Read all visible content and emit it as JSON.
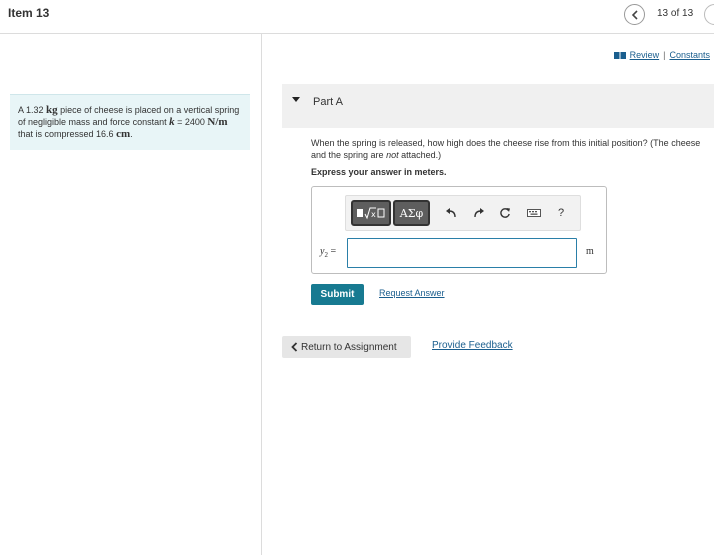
{
  "header": {
    "item_title": "Item 13",
    "page_count": "13 of 13"
  },
  "problem": {
    "text_1": "A 1.32 ",
    "mass_unit": "kg",
    "text_2": " piece of cheese is placed on a vertical spring of negligible mass and force constant ",
    "k_symbol": "k",
    "text_3": " = 2400 ",
    "k_unit": "N/m",
    "text_4": " that is compressed 16.6 ",
    "length_unit": "cm",
    "text_5": "."
  },
  "links": {
    "review": "Review",
    "separator": "|",
    "constants": "Constants"
  },
  "part": {
    "label": "Part A",
    "question_1": "When the spring is released, how high does the cheese rise from this initial position? (The cheese and the spring are ",
    "question_emph": "not",
    "question_2": " attached.)",
    "instruction": "Express your answer in meters."
  },
  "answer": {
    "variable": "y",
    "subscript": "2",
    "equals": "=",
    "value": "",
    "unit": "m",
    "toolbar": {
      "templates_label": "√□",
      "greek_label": "ΑΣφ",
      "help_label": "?"
    }
  },
  "buttons": {
    "submit": "Submit",
    "request_answer": "Request Answer",
    "return": "Return to Assignment",
    "feedback": "Provide Feedback"
  },
  "colors": {
    "accent": "#177a91",
    "link": "#1a5e8e",
    "problem_bg": "#e8f5f7",
    "part_bg": "#f0f0f0"
  }
}
